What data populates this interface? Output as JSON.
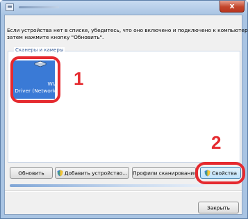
{
  "window": {
    "close_glyph": "x"
  },
  "info": {
    "line1": "Если устройства нет в списке, убедитесь, что оно включено и подключено к компьютеру,",
    "line2": "затем нажмите кнопку \"Обновить\"."
  },
  "devices": {
    "group_label": "Сканеры и камеры",
    "items": [
      {
        "label_line1": "WIA",
        "label_line2": "Driver (Network)",
        "icon": "scanner-icon",
        "selected": true
      }
    ]
  },
  "buttons": {
    "refresh": "Обновить",
    "add_device": "Добавить устройство...",
    "scan_profiles": "Профили сканирования",
    "properties": "Свойства",
    "close": "Закрыть"
  },
  "callouts": {
    "first": "1",
    "second": "2"
  },
  "colors": {
    "highlight": "#e52a2f",
    "selection": "#3a7ad6",
    "window_frame": "#a9c4e3"
  }
}
